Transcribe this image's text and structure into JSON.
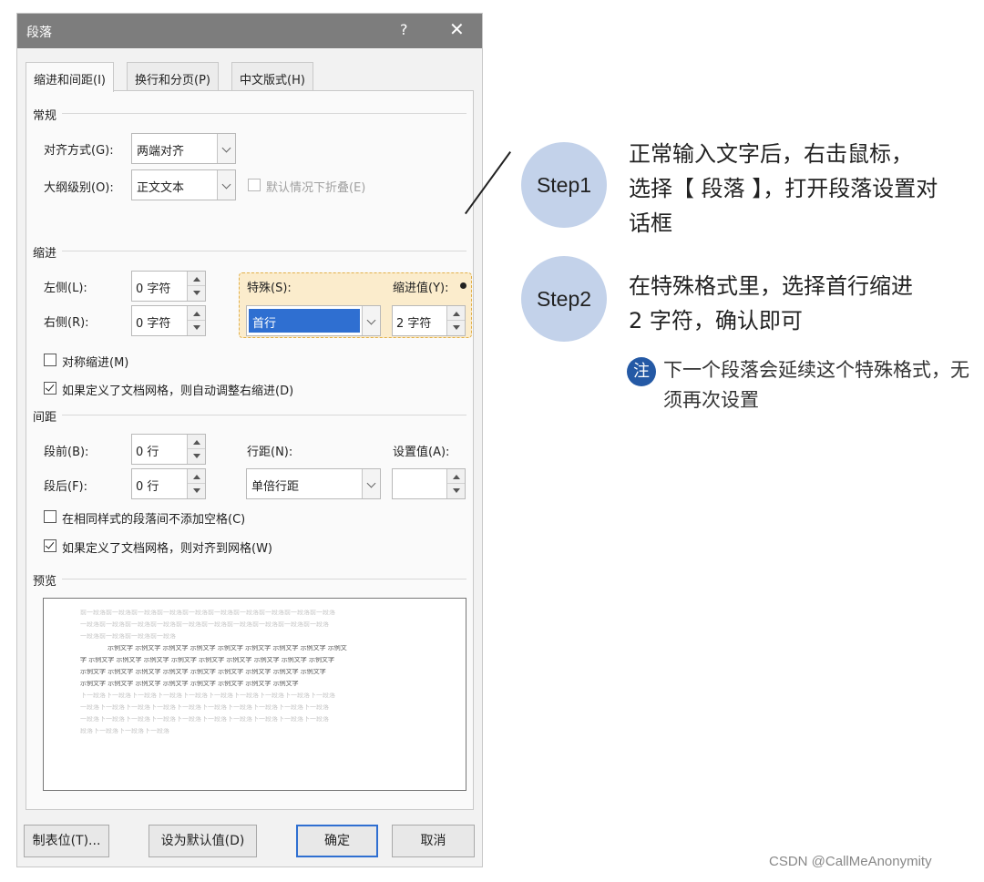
{
  "dialog": {
    "title": "段落",
    "help": "?",
    "close": "✕",
    "tabs": [
      "缩进和间距(I)",
      "换行和分页(P)",
      "中文版式(H)"
    ],
    "general": {
      "section": "常规",
      "alignment_label": "对齐方式(G):",
      "alignment_value": "两端对齐",
      "outline_label": "大纲级别(O):",
      "outline_value": "正文文本",
      "collapse_label": "默认情况下折叠(E)"
    },
    "indent": {
      "section": "缩进",
      "left_label": "左侧(L):",
      "left_value": "0 字符",
      "right_label": "右侧(R):",
      "right_value": "0 字符",
      "special_label": "特殊(S):",
      "special_value": "首行",
      "by_label": "缩进值(Y):",
      "by_value": "2 字符",
      "mirror_label": "对称缩进(M)",
      "auto_adjust_label": "如果定义了文档网格，则自动调整右缩进(D)"
    },
    "spacing": {
      "section": "间距",
      "before_label": "段前(B):",
      "before_value": "0 行",
      "after_label": "段后(F):",
      "after_value": "0 行",
      "line_label": "行距(N):",
      "line_value": "单倍行距",
      "at_label": "设置值(A):",
      "at_value": "",
      "no_space_label": "在相同样式的段落间不添加空格(C)",
      "snap_grid_label": "如果定义了文档网格，则对齐到网格(W)"
    },
    "preview": {
      "section": "预览",
      "lines_before": [
        "前一段落前一段落前一段落前一段落前一段落前一段落前一段落前一段落前一段落前一段落",
        "一段落前一段落前一段落前一段落前一段落前一段落前一段落前一段落前一段落前一段落",
        "一段落前一段落前一段落前一段落"
      ],
      "lines_sample": [
        "示例文字 示例文字 示例文字 示例文字 示例文字 示例文字 示例文字 示例文字 示例文",
        "字 示例文字 示例文字 示例文字 示例文字 示例文字 示例文字 示例文字 示例文字 示例文字",
        "示例文字 示例文字 示例文字 示例文字 示例文字 示例文字 示例文字 示例文字 示例文字",
        "示例文字 示例文字 示例文字 示例文字 示例文字 示例文字 示例文字 示例文字"
      ],
      "lines_after": [
        "下一段落下一段落下一段落下一段落下一段落下一段落下一段落下一段落下一段落下一段落",
        "一段落下一段落下一段落下一段落下一段落下一段落下一段落下一段落下一段落下一段落",
        "一段落下一段落下一段落下一段落下一段落下一段落下一段落下一段落下一段落下一段落",
        "段落下一段落下一段落下一段落"
      ]
    },
    "buttons": {
      "tabs": "制表位(T)...",
      "set_default": "设为默认值(D)",
      "ok": "确定",
      "cancel": "取消"
    }
  },
  "annotations": {
    "step1_label": "Step1",
    "step1_text": [
      "正常输入文字后，右击鼠标，",
      "选择【 段落 】，打开段落设置对",
      "话框"
    ],
    "step2_label": "Step2",
    "step2_text": [
      "在特殊格式里，选择首行缩进",
      "2 字符，确认即可"
    ],
    "note_icon": "注",
    "note_text": "下一个段落会延续这个特殊格式，无须再次设置"
  },
  "watermark": "CSDN @CallMeAnonymity",
  "colors": {
    "titlebar": "#7d7d7d",
    "step_circle": "#c3d2ea",
    "highlight": "#fbeccc",
    "note_icon": "#2459a5",
    "selection": "#2f6fd1"
  }
}
